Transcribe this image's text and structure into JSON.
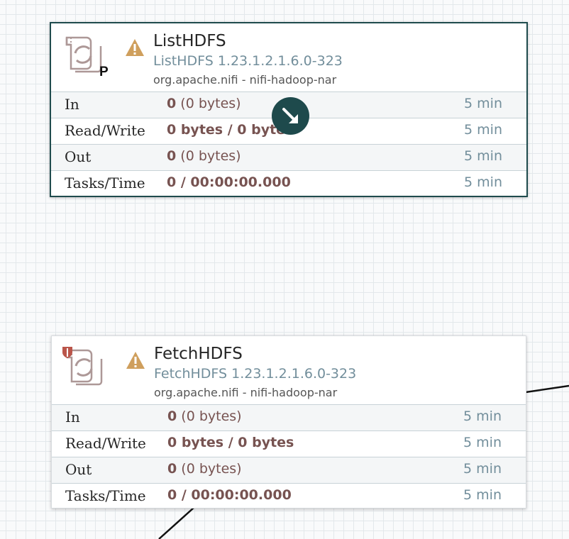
{
  "colors": {
    "selected_border": "#1f4b4d",
    "stat_value": "#775351",
    "type_text": "#728e9b",
    "warning": "#cf9f5d",
    "restricted": "#ba554a",
    "run_indicator": "#1e4a4c"
  },
  "processors": [
    {
      "name": "ListHDFS",
      "type": "ListHDFS 1.23.1.2.1.6.0-323",
      "bundle": "org.apache.nifi - nifi-hadoop-nar",
      "icon": "processor-icon",
      "badge": "P",
      "status_icon": "warning-icon",
      "selected": true,
      "stats": {
        "in": {
          "label": "In",
          "count": "0",
          "size": "(0 bytes)",
          "window": "5 min"
        },
        "read_write": {
          "label": "Read/Write",
          "value": "0 bytes / 0 bytes",
          "window": "5 min"
        },
        "out": {
          "label": "Out",
          "count": "0",
          "size": "(0 bytes)",
          "window": "5 min"
        },
        "tasks_time": {
          "label": "Tasks/Time",
          "value": "0 / 00:00:00.000",
          "window": "5 min"
        }
      }
    },
    {
      "name": "FetchHDFS",
      "type": "FetchHDFS 1.23.1.2.1.6.0-323",
      "bundle": "org.apache.nifi - nifi-hadoop-nar",
      "icon": "processor-icon",
      "restricted_icon": "shield-icon",
      "status_icon": "warning-icon",
      "selected": false,
      "stats": {
        "in": {
          "label": "In",
          "count": "0",
          "size": "(0 bytes)",
          "window": "5 min"
        },
        "read_write": {
          "label": "Read/Write",
          "value": "0 bytes / 0 bytes",
          "window": "5 min"
        },
        "out": {
          "label": "Out",
          "count": "0",
          "size": "(0 bytes)",
          "window": "5 min"
        },
        "tasks_time": {
          "label": "Tasks/Time",
          "value": "0 / 00:00:00.000",
          "window": "5 min"
        }
      }
    }
  ],
  "overlay": {
    "icon": "connection-drag-arrow-icon"
  }
}
